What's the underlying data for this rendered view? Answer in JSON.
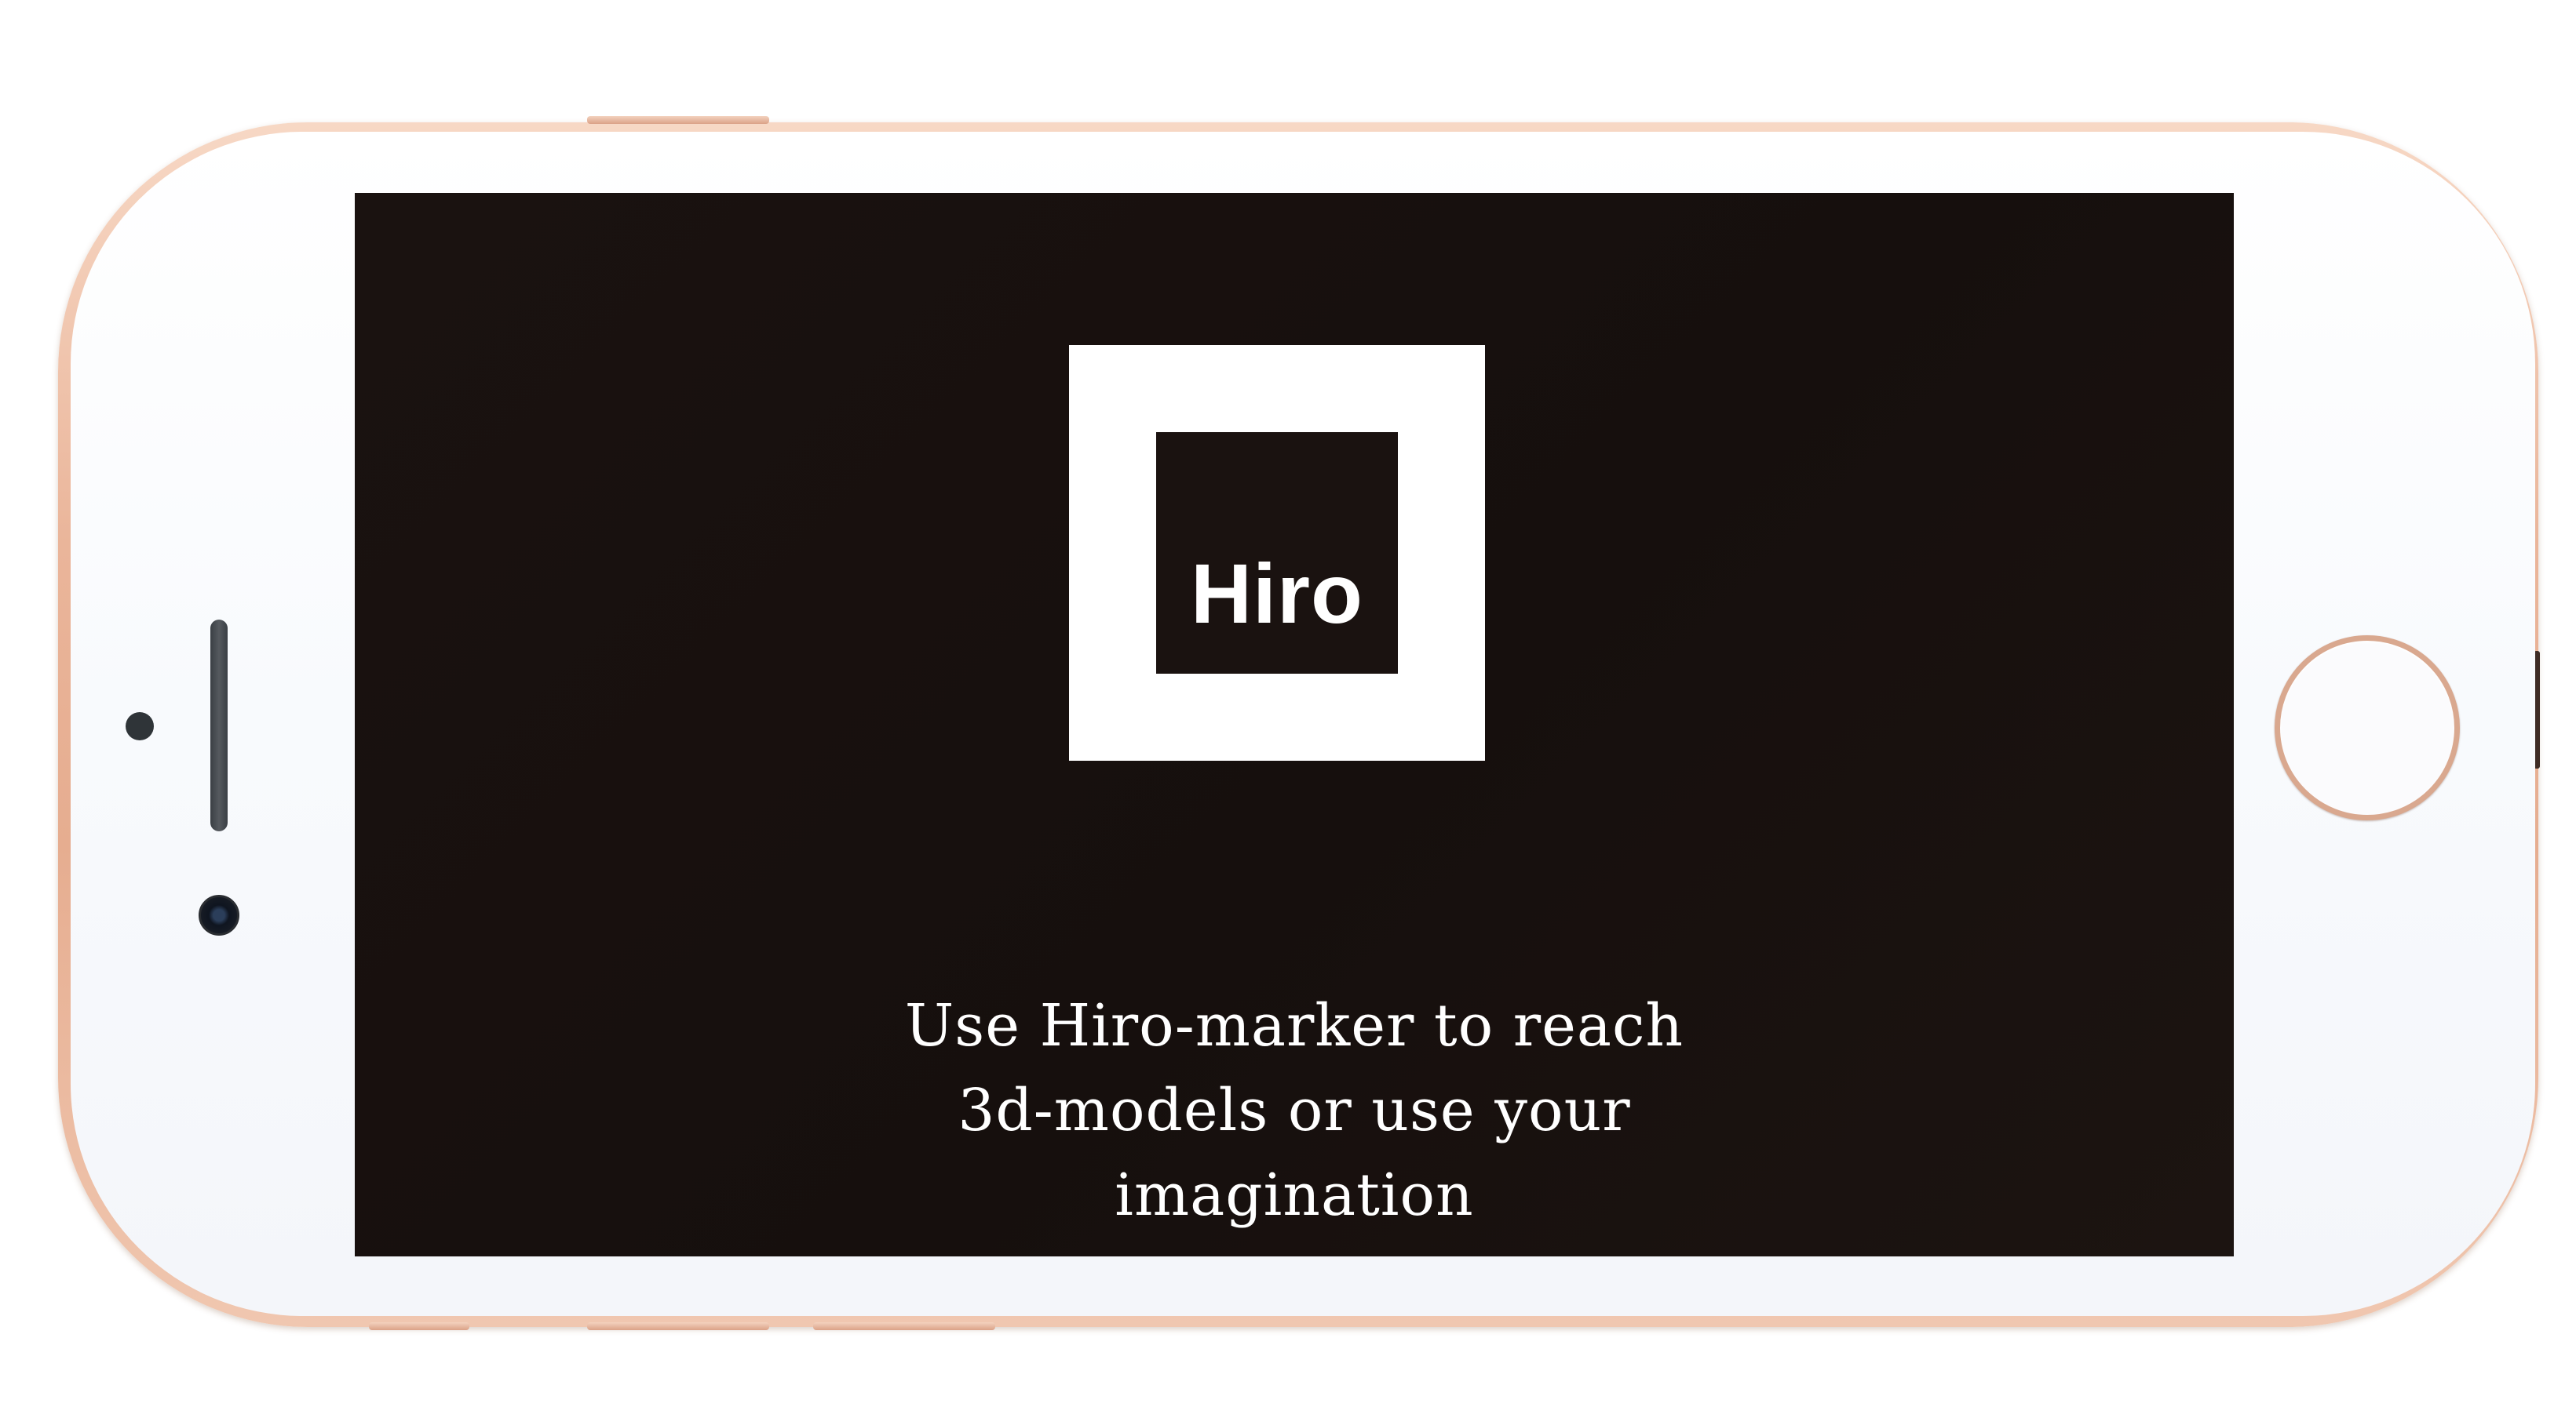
{
  "marker": {
    "label": "Hiro"
  },
  "instructions": {
    "lines": [
      "Use Hiro-marker to reach",
      "3d-models or use your",
      "imagination"
    ]
  },
  "colors": {
    "screen_background": "#1a1210",
    "marker_frame": "#ffffff",
    "text": "#ffffff",
    "phone_body": "#e8b397"
  },
  "device": {
    "icons": [
      "home-button",
      "front-camera",
      "earpiece-speaker",
      "proximity-sensor"
    ]
  }
}
